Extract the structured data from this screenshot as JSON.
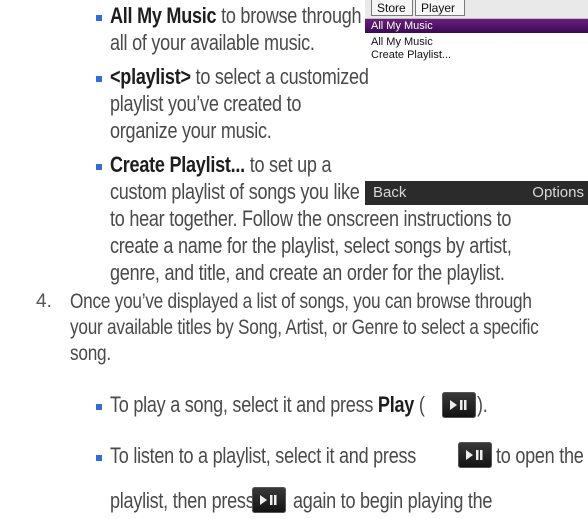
{
  "bullets": {
    "all_my_music": {
      "term": "All My Music",
      "line1": " to browse through",
      "line2": "all of your available music."
    },
    "playlist": {
      "term": "<playlist>",
      "line1": " to select a customized",
      "line2": "playlist you’ve created to",
      "line3": "organize your music."
    },
    "create": {
      "term": "Create Playlist...",
      "line1": " to set up a",
      "line2": "custom playlist of songs you like",
      "line3": "to hear together. Follow the onscreen instructions to",
      "line4": "create a name for the playlist, select songs by artist,",
      "line5": "genre, and title, and create an order for the playlist."
    }
  },
  "step4": {
    "number": "4.",
    "line1": "Once you’ve displayed a list of songs, you can browse through",
    "line2": "your available titles by Song, Artist, or Genre to select a specific",
    "line3": "song."
  },
  "sub_bullets": {
    "play": {
      "text": "To play a song, select it and press ",
      "term": "Play",
      "open_paren": " (",
      "close_paren": ")."
    },
    "listen": {
      "line1_a": "To listen to a playlist, select it and press",
      "line1_b": "to open the",
      "line2_a": "playlist, then press",
      "line2_b": "again to begin playing the"
    }
  },
  "phone": {
    "tabs": [
      "Store",
      "Player"
    ],
    "highlighted": "All My Music",
    "items": [
      "All My Music",
      "Create Playlist..."
    ],
    "softkeys": {
      "left": "Back",
      "right": "Options"
    },
    "header_color": "#5a1470",
    "softbar_color": "#2b2b2b"
  },
  "icons": {
    "play_pause": "play-pause-key-icon"
  },
  "accent_color": "#2f6fd1"
}
